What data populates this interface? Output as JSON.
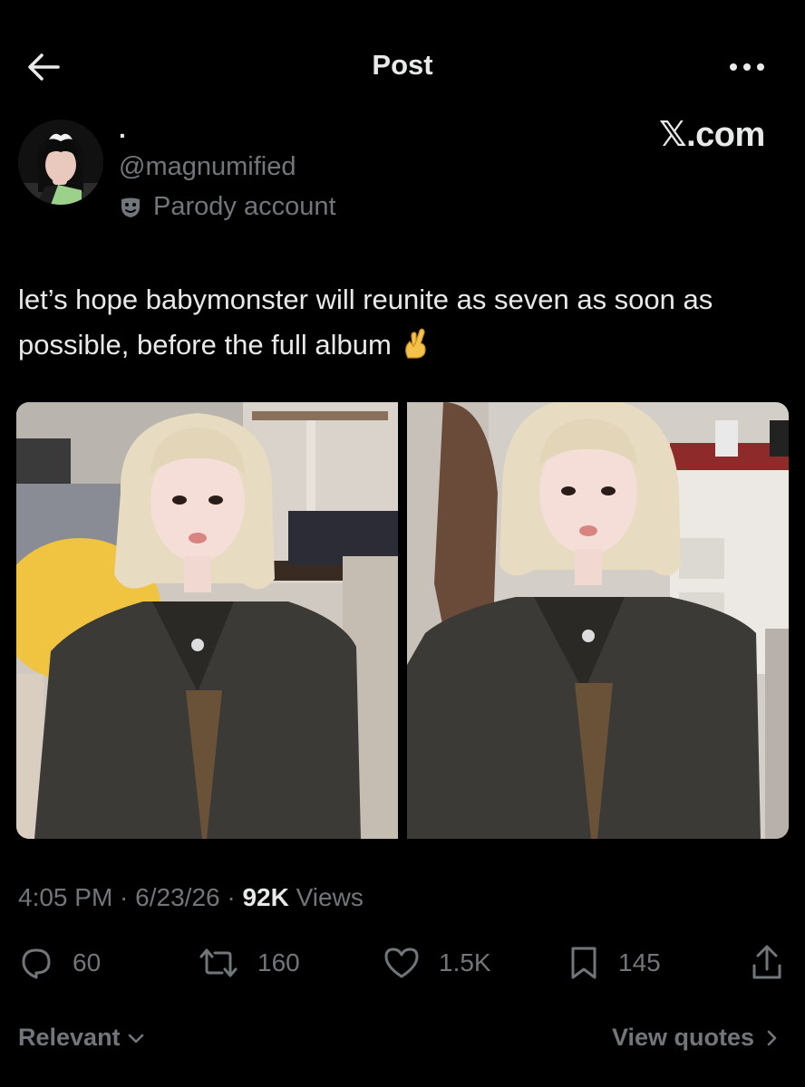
{
  "header": {
    "title": "Post",
    "back_icon": "arrow-left-icon",
    "more_icon": "more-horizontal-icon"
  },
  "watermark": "𝕏.com",
  "author": {
    "display_name": "·",
    "handle": "@magnumified",
    "label": "Parody account",
    "label_icon": "theater-mask-icon"
  },
  "tweet": {
    "text": "let’s hope babymonster will reunite as seven as soon as possible, before the full album",
    "emoji": "crossed-fingers-emoji"
  },
  "meta": {
    "time": "4:05 PM",
    "sep1": " · ",
    "date": "6/23/26",
    "sep2": " · ",
    "views_count": "92K",
    "views_label": " Views"
  },
  "actions": {
    "replies": "60",
    "reposts": "160",
    "likes": "1.5K",
    "bookmarks": "145"
  },
  "footer": {
    "sort_label": "Relevant",
    "quotes_label": "View quotes"
  },
  "colors": {
    "background": "#000000",
    "text_primary": "#e7e9ea",
    "text_secondary": "#71767b"
  }
}
